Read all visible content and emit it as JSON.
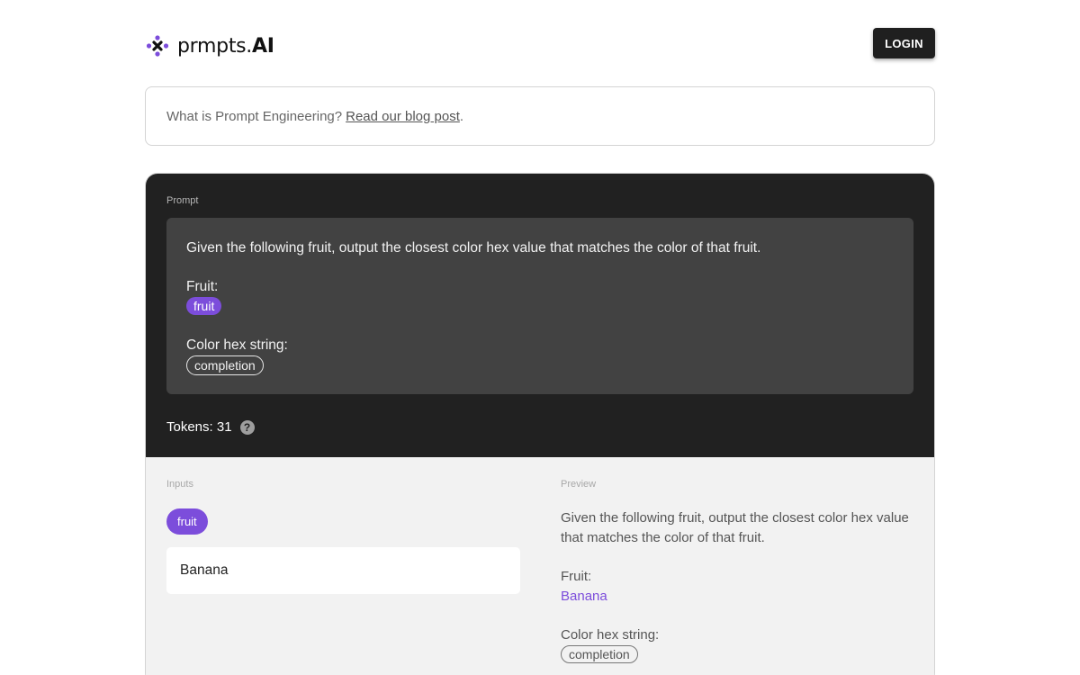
{
  "app": {
    "logo_text": "prmpts.",
    "logo_bold": "AI",
    "login_label": "LOGIN"
  },
  "info": {
    "text": "What is Prompt Engineering?",
    "link_text": "Read our blog post",
    "suffix": "."
  },
  "prompt": {
    "label": "Prompt",
    "instruction": "Given the following fruit, output the closest color hex value that matches the color of that fruit.",
    "fruit_label": "Fruit:",
    "fruit_chip": "fruit",
    "color_label": "Color hex string:",
    "completion_chip": "completion",
    "tokens_label": "Tokens: 31",
    "help_glyph": "?"
  },
  "inputs": {
    "label": "Inputs",
    "chip": "fruit",
    "value": "Banana"
  },
  "preview": {
    "label": "Preview",
    "instruction": "Given the following fruit, output the closest color hex value that matches the color of that fruit.",
    "fruit_label": "Fruit:",
    "fruit_value": "Banana",
    "color_label": "Color hex string:",
    "completion_chip": "completion"
  },
  "colors": {
    "accent": "#7c4ddb",
    "dark_panel": "#212121",
    "prompt_box": "#424242",
    "light_panel": "#f2f2f2"
  }
}
